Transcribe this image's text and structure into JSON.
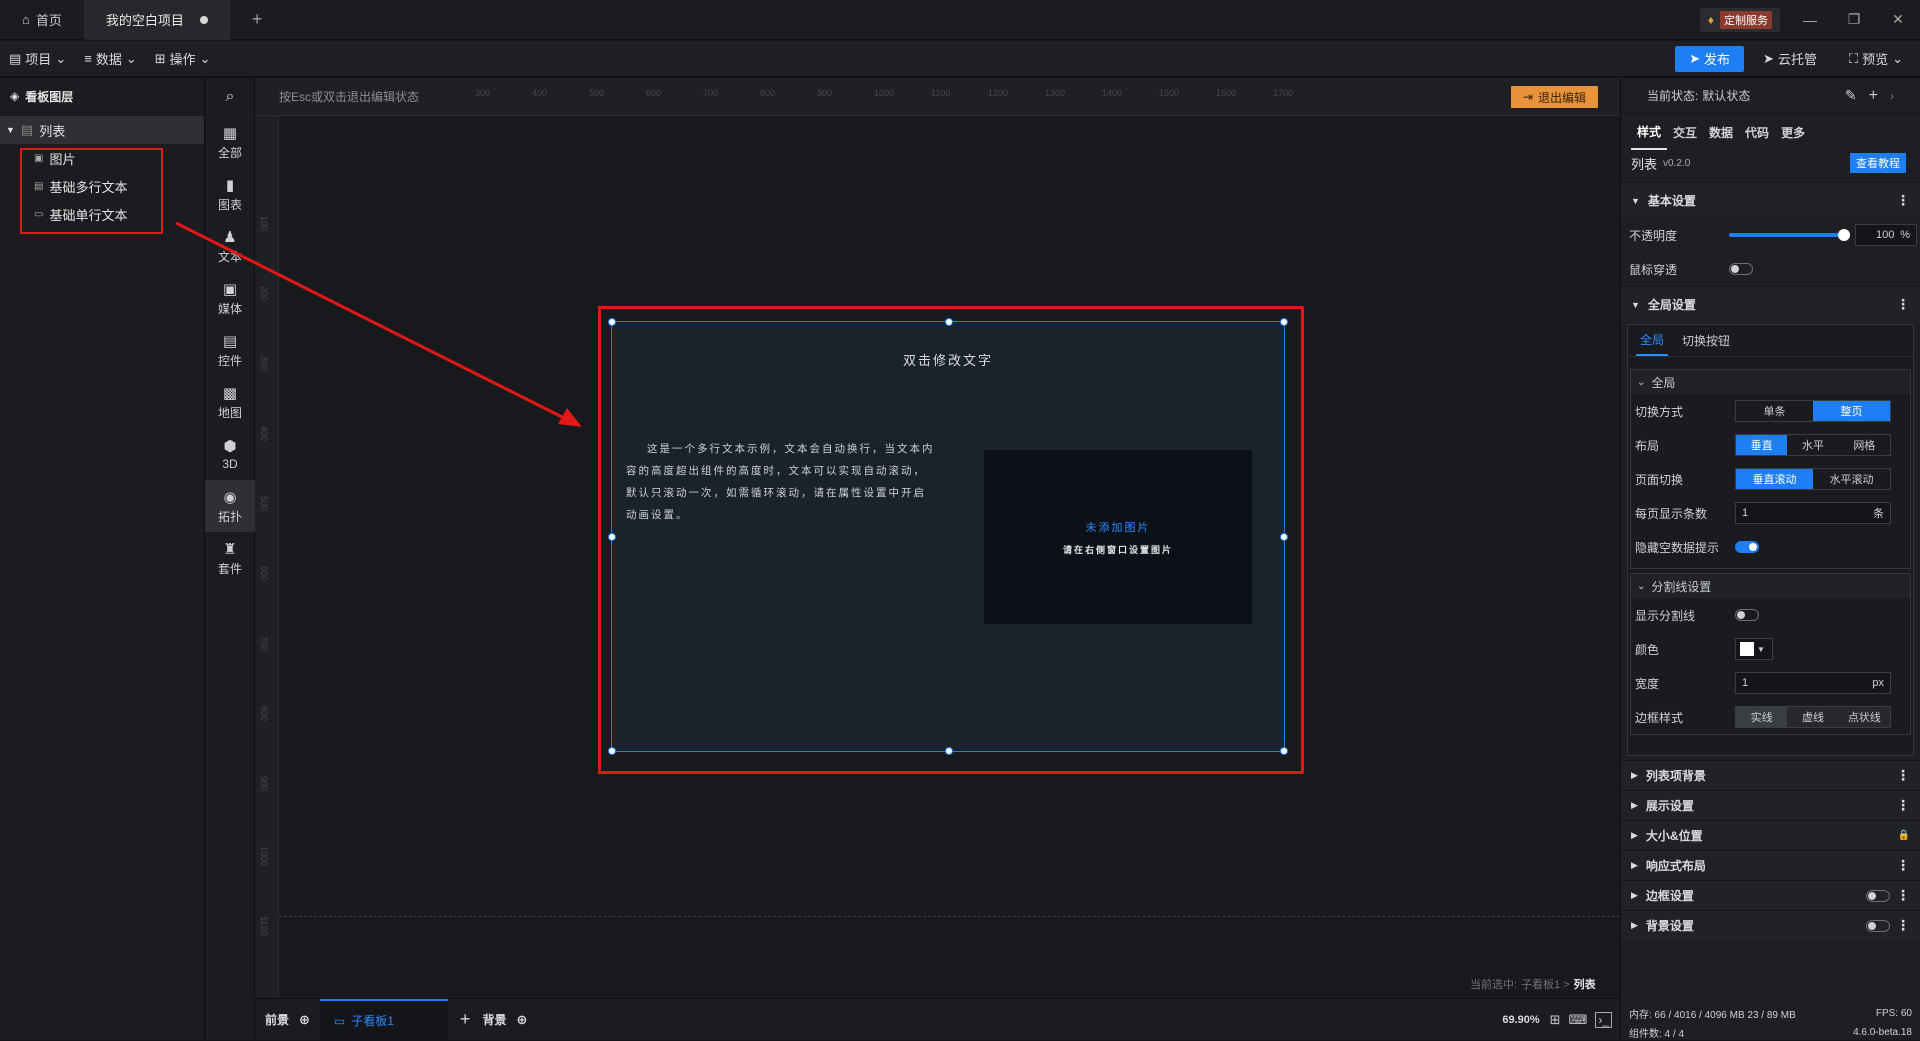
{
  "titlebar": {
    "home_tab": "首页",
    "project_tab": "我的空白项目",
    "custom_service": "定制服务"
  },
  "menubar": {
    "project": "项目",
    "data": "数据",
    "operate": "操作",
    "publish": "发布",
    "cloud": "云托管",
    "preview": "预览"
  },
  "layers": {
    "title": "看板图层",
    "root": "列表",
    "children": [
      "图片",
      "基础多行文本",
      "基础单行文本"
    ]
  },
  "tools": [
    {
      "icon": "grid-icon",
      "label": "全部"
    },
    {
      "icon": "chart-icon",
      "label": "图表"
    },
    {
      "icon": "text-icon",
      "label": "文本"
    },
    {
      "icon": "media-icon",
      "label": "媒体"
    },
    {
      "icon": "control-icon",
      "label": "控件"
    },
    {
      "icon": "map-icon",
      "label": "地图"
    },
    {
      "icon": "cube-icon",
      "label": "3D"
    },
    {
      "icon": "topology-icon",
      "label": "拓扑"
    },
    {
      "icon": "kit-icon",
      "label": "套件"
    }
  ],
  "canvas": {
    "hint": "按Esc或双击退出编辑状态",
    "exit_edit": "退出编辑",
    "ruler_top": [
      "300",
      "400",
      "500",
      "600",
      "700",
      "800",
      "900",
      "1000",
      "1100",
      "1200",
      "1300",
      "1400",
      "1500",
      "1600",
      "1700"
    ],
    "ruler_left": [
      "100",
      "200",
      "300",
      "400",
      "500",
      "600",
      "700",
      "800",
      "900",
      "1000",
      "1100"
    ],
    "component_title": "双击修改文字",
    "component_body": "这是一个多行文本示例，文本会自动换行，当文本内容的高度超出组件的高度时，文本可以实现自动滚动，默认只滚动一次，如需循环滚动，请在属性设置中开启动画设置。",
    "image_placeholder_title": "未添加图片",
    "image_placeholder_sub": "请在右侧窗口设置图片",
    "current_selected_prefix": "当前选中:",
    "current_selected_path": "子看板1 >",
    "current_selected_item": "列表"
  },
  "bottom": {
    "foreground": "前景",
    "subboard": "子看板1",
    "background": "背景",
    "zoom": "69.90%"
  },
  "props": {
    "state_label": "当前状态:",
    "state_value": "默认状态",
    "tabs": [
      "样式",
      "交互",
      "数据",
      "代码",
      "更多"
    ],
    "component_name": "列表",
    "component_version": "v0.2.0",
    "tutorial": "查看教程",
    "basic_settings": "基本设置",
    "opacity_label": "不透明度",
    "opacity_value": "100",
    "opacity_unit": "%",
    "opacity_level": 1.0,
    "mouse_through": "鼠标穿透",
    "global_settings": "全局设置",
    "global_tabs": [
      "全局",
      "切换按钮"
    ],
    "global_sub": "全局",
    "switch_mode_label": "切换方式",
    "switch_mode_options": [
      "单条",
      "整页"
    ],
    "layout_label": "布局",
    "layout_options": [
      "垂直",
      "水平",
      "网格"
    ],
    "page_switch_label": "页面切换",
    "page_switch_options": [
      "垂直滚动",
      "水平滚动"
    ],
    "per_page_label": "每页显示条数",
    "per_page_value": "1",
    "per_page_unit": "条",
    "hide_empty_label": "隐藏空数据提示",
    "divider_settings": "分割线设置",
    "show_divider_label": "显示分割线",
    "color_label": "颜色",
    "width_label": "宽度",
    "width_value": "1",
    "width_unit": "px",
    "border_style_label": "边框样式",
    "border_style_options": [
      "实线",
      "虚线",
      "点状线"
    ],
    "collapsed_sections": [
      "列表项背景",
      "展示设置",
      "大小&位置",
      "响应式布局",
      "边框设置",
      "背景设置"
    ],
    "status_memory": "内存:  66 / 4016 / 4096 MB  23 / 89 MB",
    "status_fps": "FPS:  60",
    "status_components": "组件数: 4 / 4",
    "version": "4.6.0-beta.18"
  },
  "colors": {
    "accent": "#1e7ff5",
    "highlight_red": "#e01818",
    "exit_orange": "#e8923a"
  }
}
